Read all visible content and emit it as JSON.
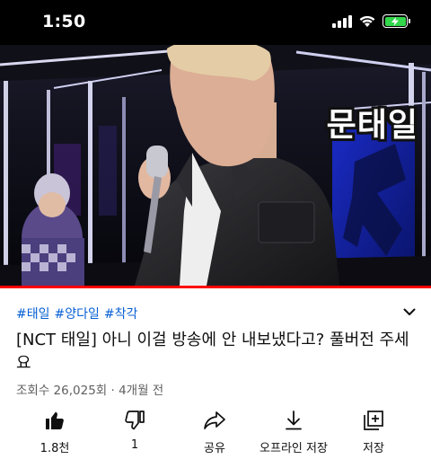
{
  "status_bar": {
    "time": "1:50",
    "battery_level": 1.0,
    "battery_color": "#32d74b"
  },
  "video": {
    "caption_overlay": "문태일",
    "progress": 1.0,
    "progress_color": "#ff0000"
  },
  "hashtags": [
    "#태일",
    "#양다일",
    "#착각"
  ],
  "title": "[NCT 태일] 아니 이걸 방송에 안 내보냈다고? 풀버전 주세요",
  "meta": "조회수 26,025회 · 4개월 전",
  "actions": [
    {
      "label": "1.8천",
      "icon": "thumbs-up-filled-icon"
    },
    {
      "label": "1",
      "icon": "thumbs-down-icon"
    },
    {
      "label": "공유",
      "icon": "share-icon"
    },
    {
      "label": "오프라인 저장",
      "icon": "download-icon"
    },
    {
      "label": "저장",
      "icon": "add-to-playlist-icon"
    }
  ],
  "colors": {
    "link": "#065fd4",
    "meta": "#606060",
    "text": "#0f0f0f"
  }
}
